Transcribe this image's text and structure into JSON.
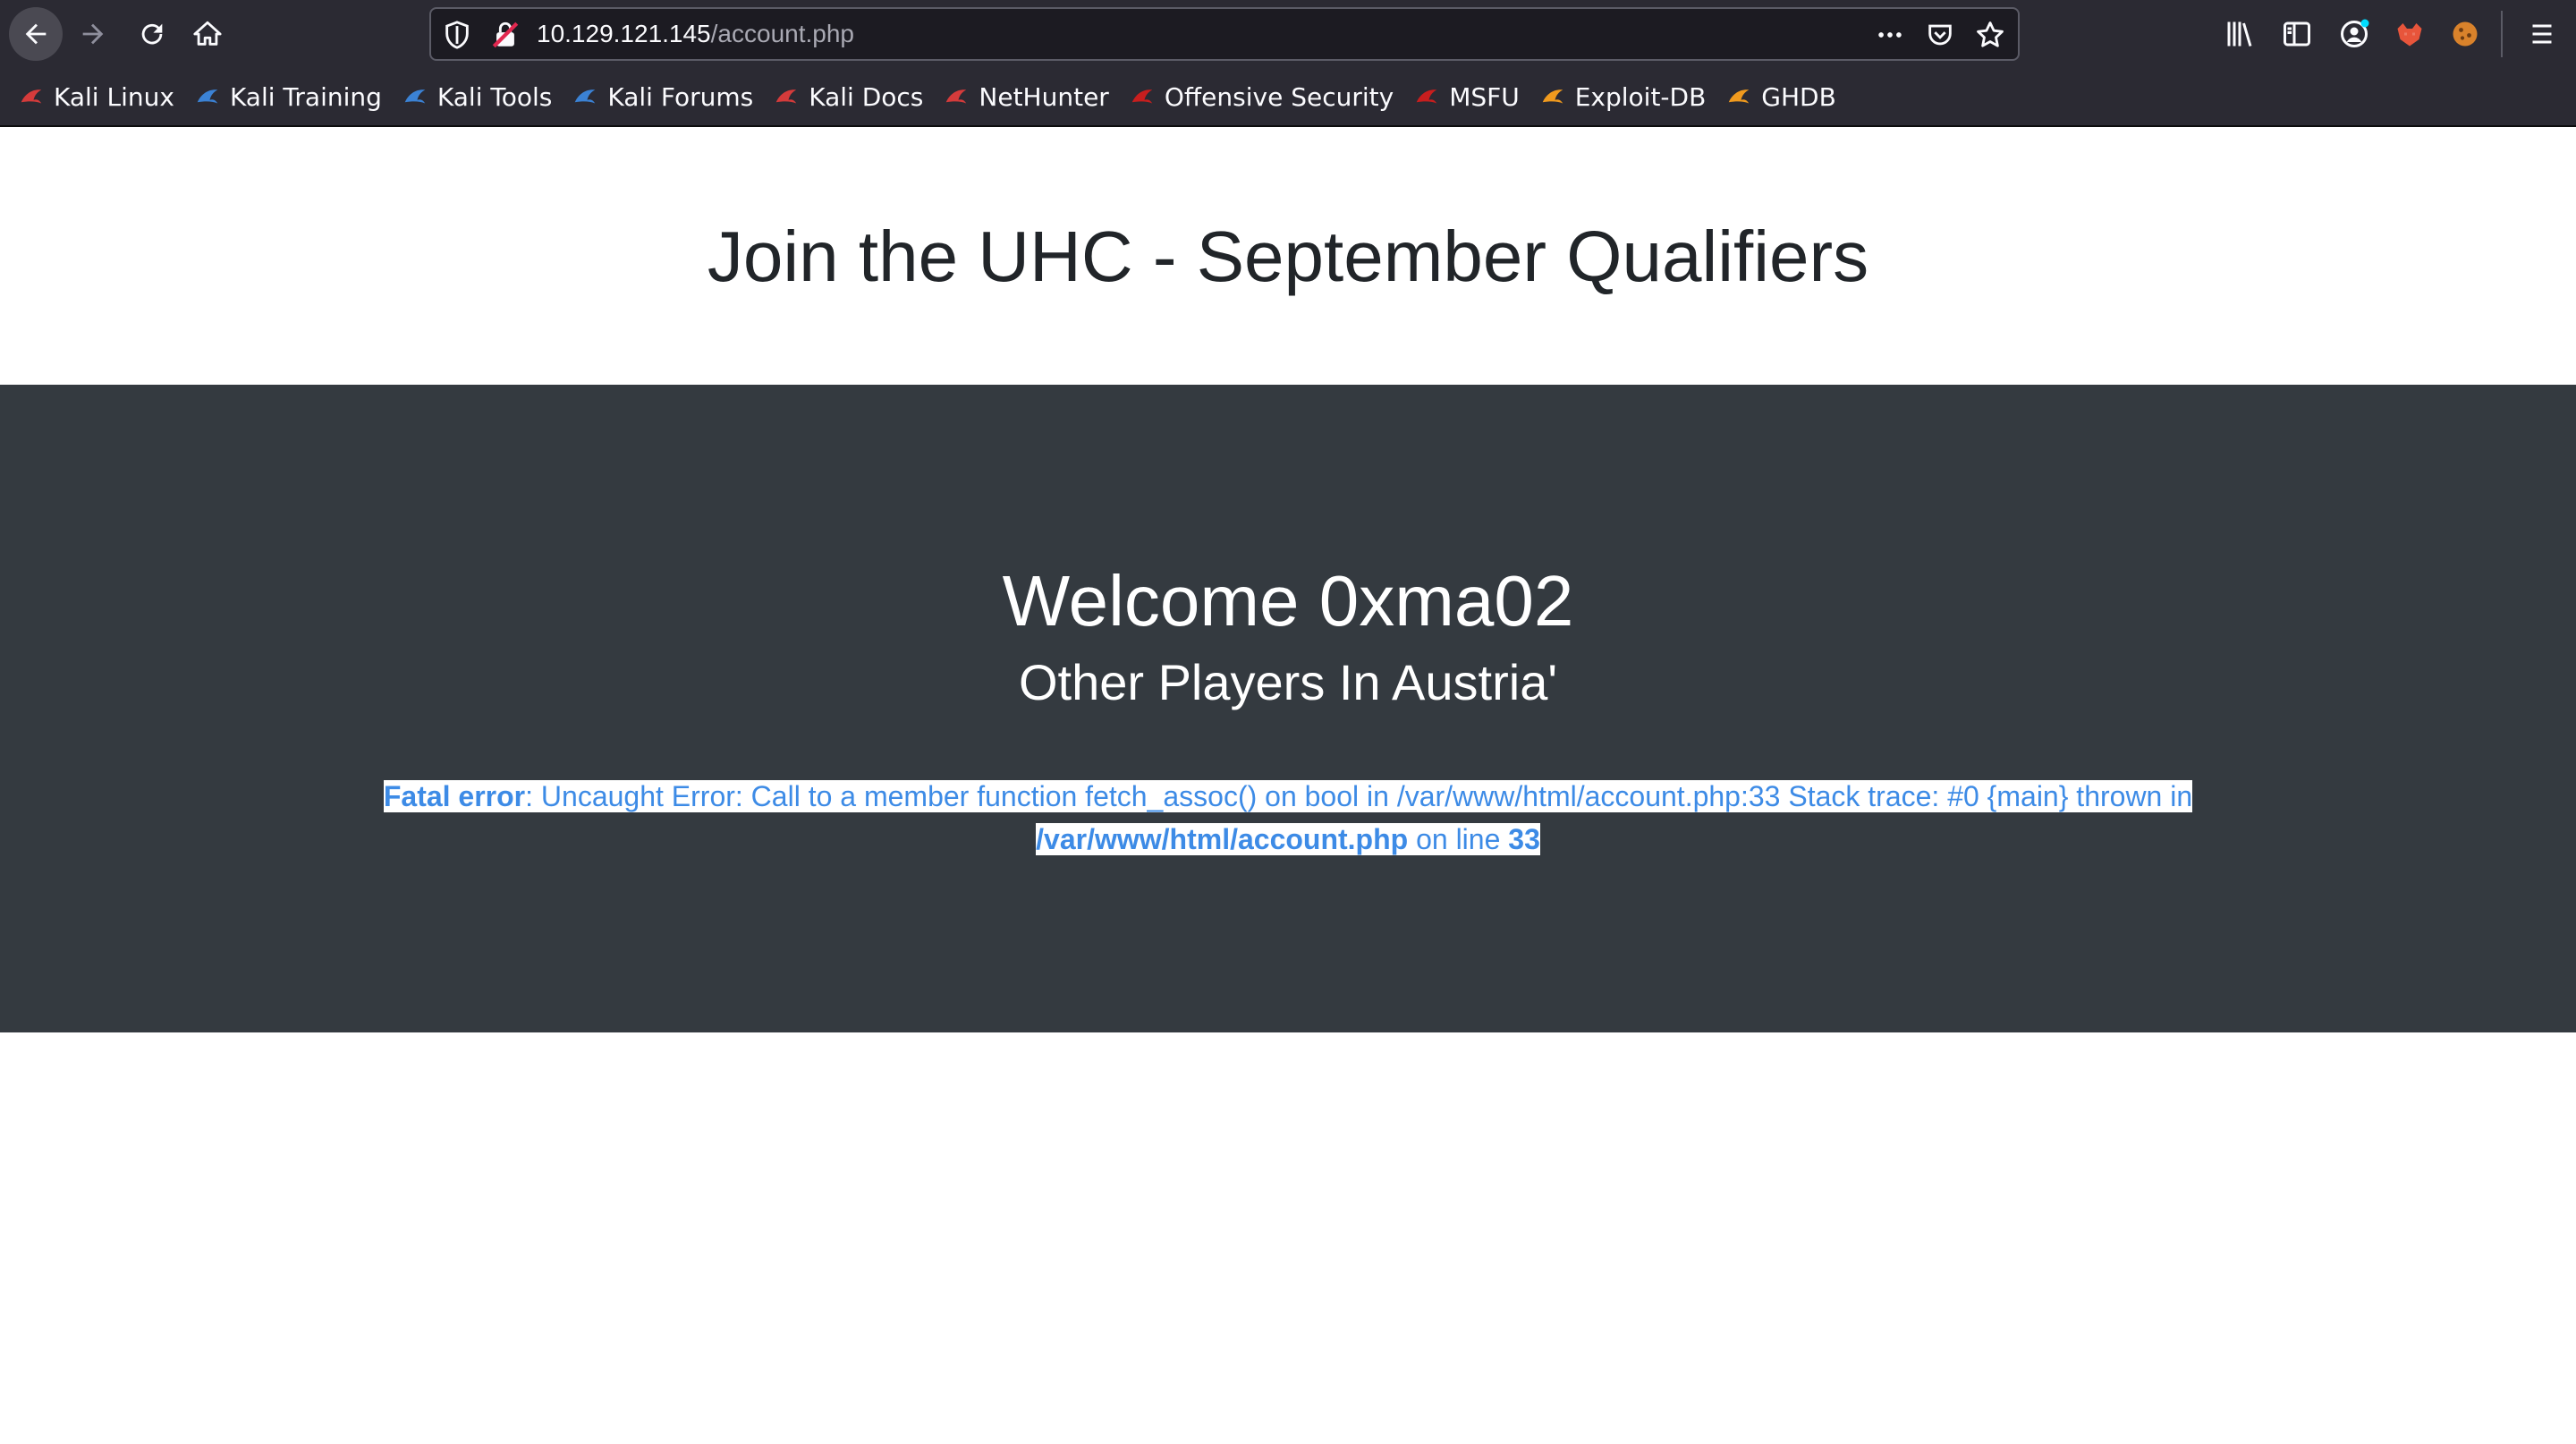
{
  "browser": {
    "url_host": "10.129.121.145",
    "url_path": "/account.php",
    "bookmarks": [
      {
        "label": "Kali Linux",
        "icon": "kali-dragon-icon",
        "color": "#d53b3b"
      },
      {
        "label": "Kali Training",
        "icon": "kali-training-icon",
        "color": "#3b82d5"
      },
      {
        "label": "Kali Tools",
        "icon": "kali-tools-icon",
        "color": "#3b82d5"
      },
      {
        "label": "Kali Forums",
        "icon": "kali-forums-icon",
        "color": "#3b82d5"
      },
      {
        "label": "Kali Docs",
        "icon": "kali-docs-icon",
        "color": "#d53b3b"
      },
      {
        "label": "NetHunter",
        "icon": "nethunter-icon",
        "color": "#d53b3b"
      },
      {
        "label": "Offensive Security",
        "icon": "offsec-icon",
        "color": "#c81e1e"
      },
      {
        "label": "MSFU",
        "icon": "msfu-icon",
        "color": "#c81e1e"
      },
      {
        "label": "Exploit-DB",
        "icon": "exploit-db-icon",
        "color": "#f09a1e"
      },
      {
        "label": "GHDB",
        "icon": "ghdb-icon",
        "color": "#f09a1e"
      }
    ]
  },
  "page": {
    "title": "Join the UHC - September Qualifiers",
    "welcome": "Welcome 0xma02",
    "subtitle": "Other Players In Austria'",
    "error": {
      "label": "Fatal error",
      "message": ": Uncaught Error: Call to a member function fetch_assoc() on bool in /var/www/html/account.php:33 Stack trace: #0 {main} thrown in ",
      "file": "/var/www/html/account.php",
      "on_line": " on line ",
      "line": "33"
    }
  },
  "colors": {
    "chrome": "#2b2a33",
    "hero": "#343a40",
    "error_text": "#3d8be6"
  }
}
